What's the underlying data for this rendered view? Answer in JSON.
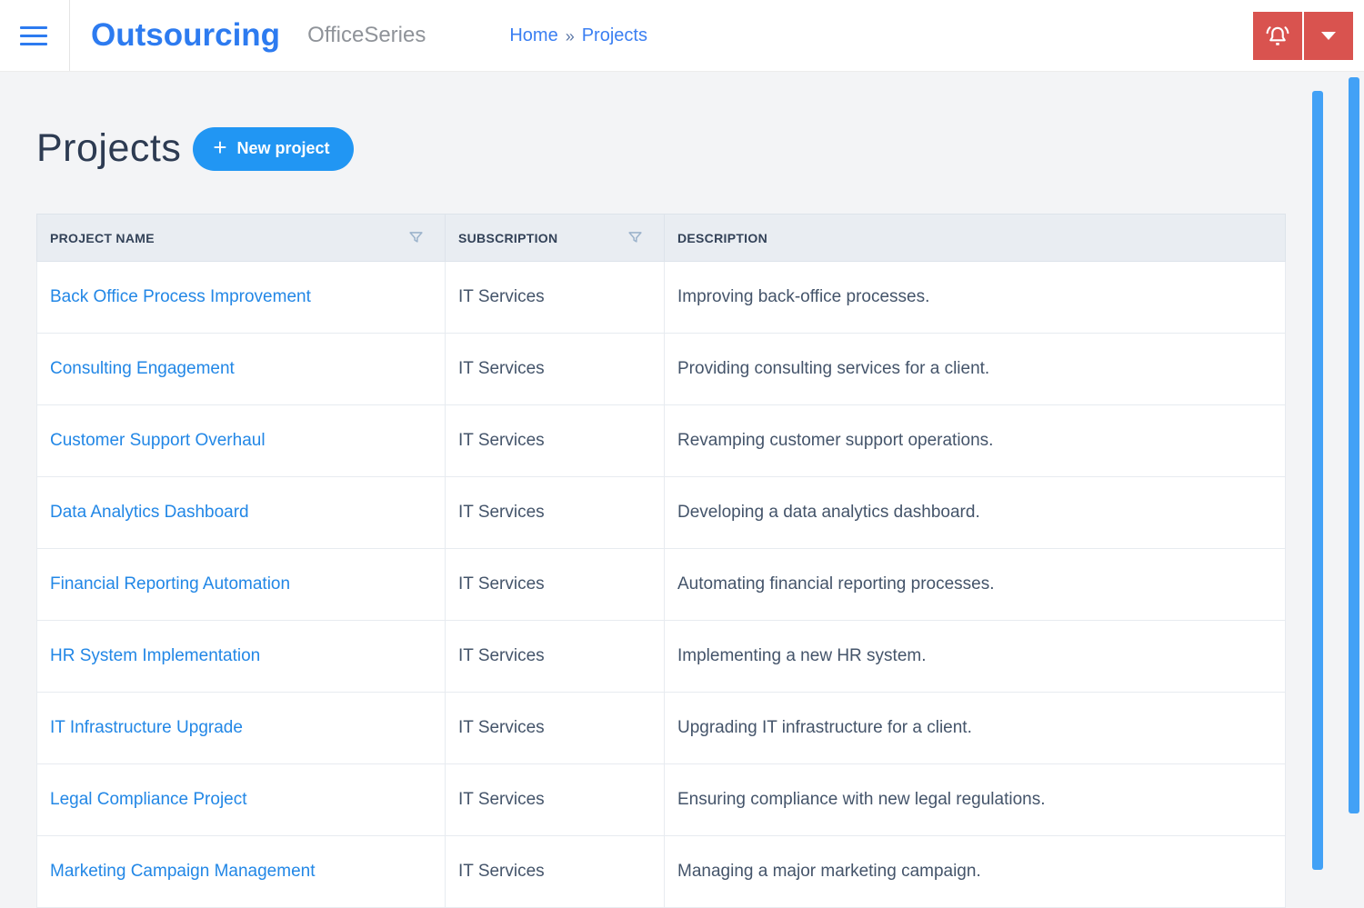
{
  "header": {
    "brand": "Outsourcing",
    "suite": "OfficeSeries",
    "breadcrumb": {
      "home": "Home",
      "separator": "»",
      "current": "Projects"
    }
  },
  "page": {
    "title": "Projects",
    "new_project_label": "New project",
    "plus_glyph": "+"
  },
  "table": {
    "columns": [
      {
        "label": "PROJECT NAME",
        "filterable": true
      },
      {
        "label": "SUBSCRIPTION",
        "filterable": true
      },
      {
        "label": "DESCRIPTION",
        "filterable": false
      }
    ],
    "rows": [
      {
        "name": "Back Office Process Improvement",
        "subscription": "IT Services",
        "description": "Improving back-office processes."
      },
      {
        "name": "Consulting Engagement",
        "subscription": "IT Services",
        "description": "Providing consulting services for a client."
      },
      {
        "name": "Customer Support Overhaul",
        "subscription": "IT Services",
        "description": "Revamping customer support operations."
      },
      {
        "name": "Data Analytics Dashboard",
        "subscription": "IT Services",
        "description": "Developing a data analytics dashboard."
      },
      {
        "name": "Financial Reporting Automation",
        "subscription": "IT Services",
        "description": "Automating financial reporting processes."
      },
      {
        "name": "HR System Implementation",
        "subscription": "IT Services",
        "description": "Implementing a new HR system."
      },
      {
        "name": "IT Infrastructure Upgrade",
        "subscription": "IT Services",
        "description": "Upgrading IT infrastructure for a client."
      },
      {
        "name": "Legal Compliance Project",
        "subscription": "IT Services",
        "description": "Ensuring compliance with new legal regulations."
      },
      {
        "name": "Marketing Campaign Management",
        "subscription": "IT Services",
        "description": "Managing a major marketing campaign."
      }
    ]
  },
  "icons": {
    "menu": "hamburger-menu",
    "notifications": "bell-ringing",
    "account": "caret-down",
    "filter": "funnel"
  },
  "colors": {
    "brand_blue": "#2d7bf0",
    "button_blue": "#2196f3",
    "link_blue": "#2287e6",
    "danger_red": "#d9534f",
    "scrollbar_blue": "#42a1f6",
    "table_header_bg": "#e9edf2",
    "page_bg": "#f3f4f6",
    "title_text": "#2d3b52"
  }
}
